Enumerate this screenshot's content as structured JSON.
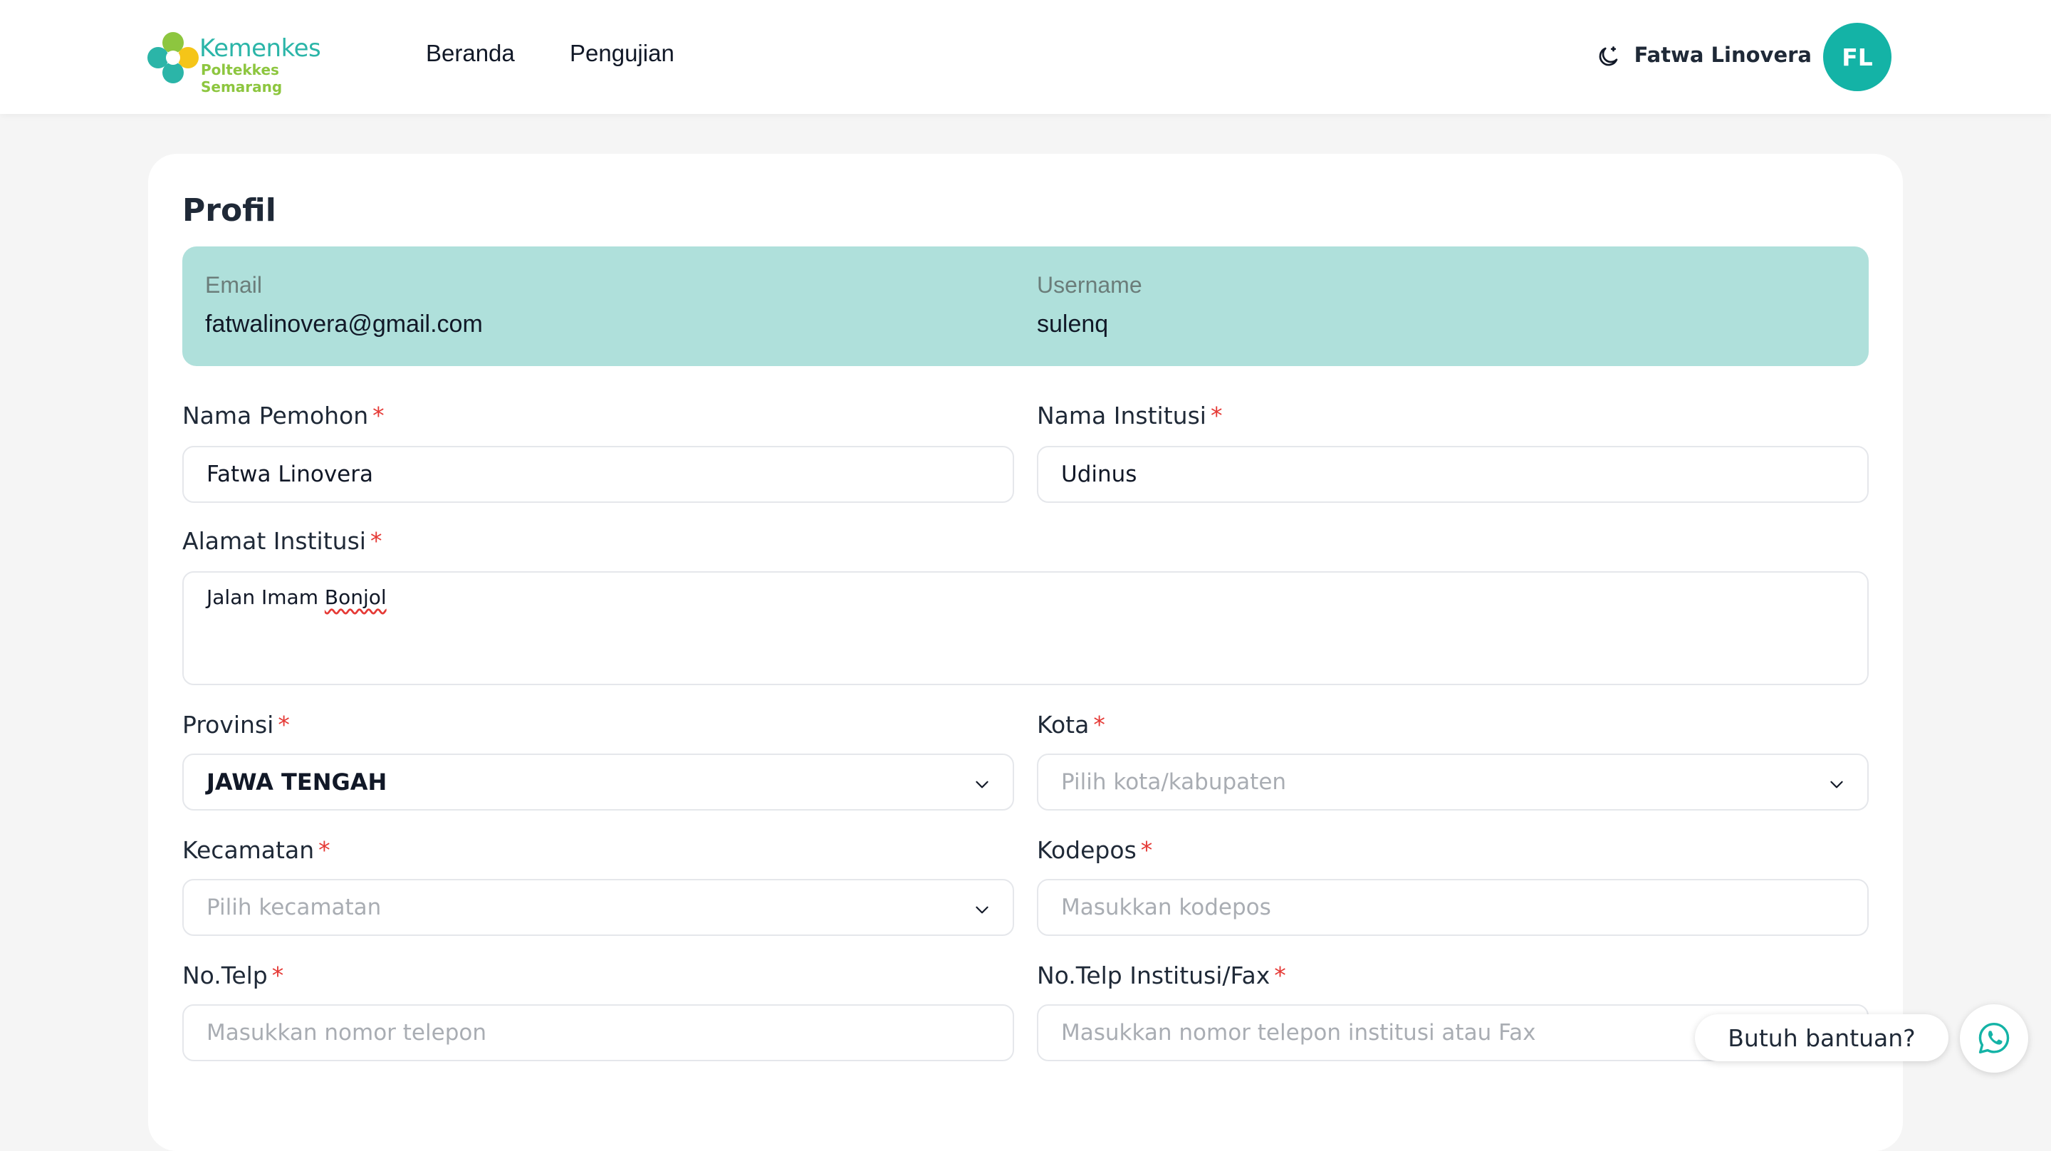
{
  "header": {
    "logo_title": "Kemenkes",
    "logo_subtitle": "Poltekkes Semarang",
    "nav": [
      {
        "label": "Beranda"
      },
      {
        "label": "Pengujian"
      }
    ],
    "user_name": "Fatwa Linovera",
    "avatar_initials": "FL",
    "theme_icon": "moon-icon"
  },
  "profile": {
    "title": "Profil",
    "account": {
      "email_label": "Email",
      "email_value": "fatwalinovera@gmail.com",
      "username_label": "Username",
      "username_value": "sulenq"
    },
    "required_mark": "*",
    "fields": {
      "nama_pemohon": {
        "label": "Nama Pemohon",
        "value": "Fatwa Linovera"
      },
      "nama_institusi": {
        "label": "Nama Institusi",
        "value": "Udinus"
      },
      "alamat_institusi": {
        "label": "Alamat Institusi",
        "value_plain": "Jalan Imam ",
        "value_misspelled": "Bonjol"
      },
      "provinsi": {
        "label": "Provinsi",
        "value": "JAWA TENGAH"
      },
      "kota": {
        "label": "Kota",
        "placeholder": "Pilih kota/kabupaten"
      },
      "kecamatan": {
        "label": "Kecamatan",
        "placeholder": "Pilih kecamatan"
      },
      "kodepos": {
        "label": "Kodepos",
        "placeholder": "Masukkan kodepos"
      },
      "no_telp": {
        "label": "No.Telp",
        "placeholder": "Masukkan nomor telepon"
      },
      "no_telp_institusi": {
        "label": "No.Telp Institusi/Fax",
        "placeholder": "Masukkan nomor telepon institusi atau Fax"
      }
    }
  },
  "help": {
    "label": "Butuh bantuan?",
    "icon": "whatsapp-icon"
  },
  "colors": {
    "accent": "#14b3a6",
    "account_box": "#afe0db",
    "required": "#e53935",
    "logo_green": "#8dc63f"
  }
}
